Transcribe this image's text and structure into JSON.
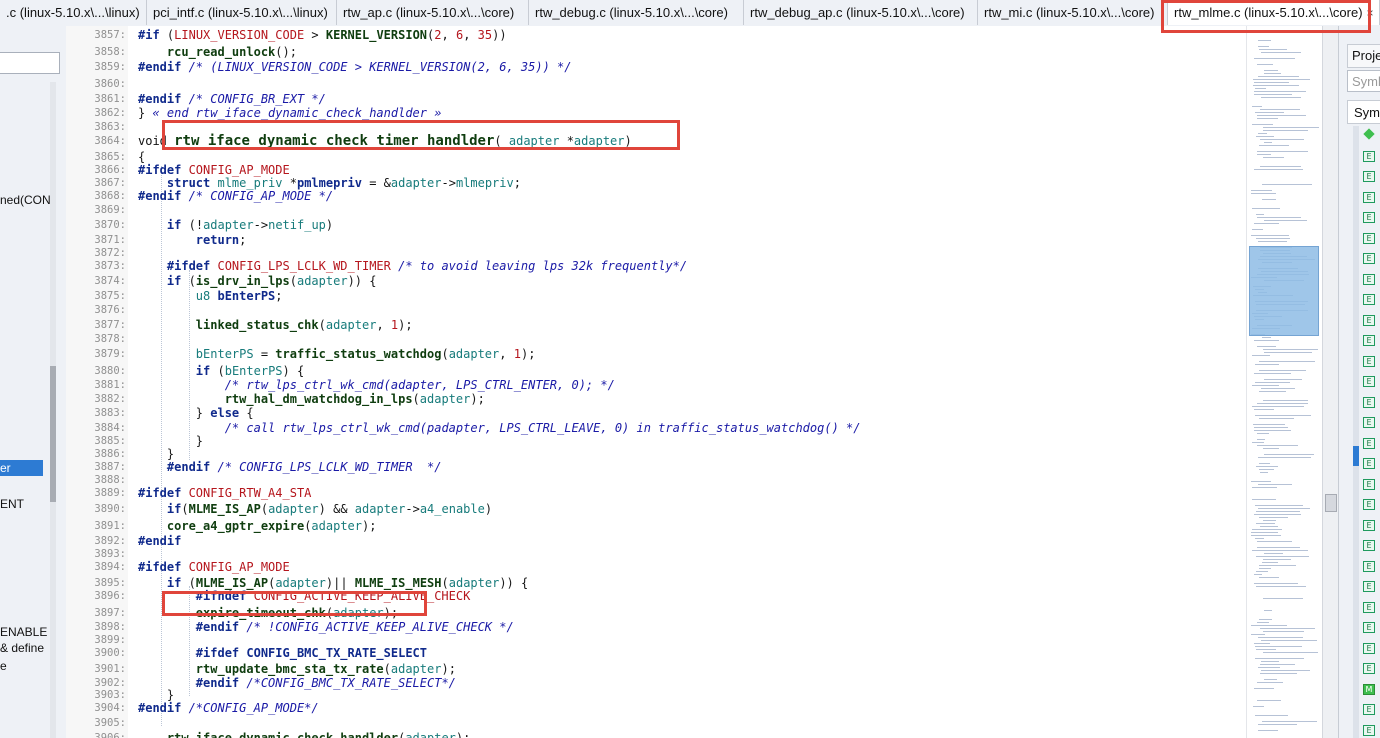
{
  "tabs": [
    {
      "label": ".c (linux-5.10.x\\...\\linux)",
      "active": false,
      "close": ""
    },
    {
      "label": "pci_intf.c (linux-5.10.x\\...\\linux)",
      "active": false,
      "close": ""
    },
    {
      "label": "rtw_ap.c (linux-5.10.x\\...\\core)",
      "active": false,
      "close": ""
    },
    {
      "label": "rtw_debug.c (linux-5.10.x\\...\\core)",
      "active": false,
      "close": ""
    },
    {
      "label": "rtw_debug_ap.c (linux-5.10.x\\...\\core)",
      "active": false,
      "close": ""
    },
    {
      "label": "rtw_mi.c (linux-5.10.x\\...\\core)",
      "active": false,
      "close": ""
    },
    {
      "label": "rtw_mlme.c (linux-5.10.x\\...\\core)",
      "active": true,
      "close": "×"
    }
  ],
  "left_panel": {
    "items": [
      {
        "label": "ned(CON",
        "selected": false
      },
      {
        "label": "er",
        "selected": true
      },
      {
        "label": "ENT",
        "selected": false
      },
      {
        "label": "ENABLE",
        "selected": false
      },
      {
        "label": "& define",
        "selected": false
      },
      {
        "label": "e",
        "selected": false
      }
    ]
  },
  "right_panel": {
    "tab_label": "Project",
    "search_placeholder": "Symbol",
    "header": "Symbol",
    "icons": [
      "diamond",
      "E",
      "E",
      "E",
      "E",
      "E",
      "E",
      "E",
      "E",
      "E",
      "E",
      "E",
      "E",
      "E",
      "E",
      "E",
      "E",
      "E",
      "E",
      "E",
      "E",
      "E",
      "E",
      "E",
      "E",
      "E",
      "E",
      "M",
      "E",
      "E"
    ]
  },
  "code": {
    "lines": [
      {
        "n": "3857:",
        "html_parts": [
          [
            "pp",
            "#if "
          ],
          [
            "par",
            "("
          ],
          [
            "mac",
            "LINUX_VERSION_CODE"
          ],
          [
            "plain",
            " > "
          ],
          [
            "fn",
            "KERNEL_VERSION"
          ],
          [
            "par",
            "("
          ],
          [
            "num",
            "2"
          ],
          [
            "plain",
            ", "
          ],
          [
            "num",
            "6"
          ],
          [
            "plain",
            ", "
          ],
          [
            "num",
            "35"
          ],
          [
            "par",
            "))"
          ]
        ]
      },
      {
        "n": "3858:",
        "html_parts": [
          [
            "plain",
            "    "
          ],
          [
            "fn",
            "rcu_read_unlock"
          ],
          [
            "par",
            "();"
          ]
        ]
      },
      {
        "n": "3859:",
        "html_parts": [
          [
            "pp",
            "#endif "
          ],
          [
            "cm",
            "/* (LINUX_VERSION_CODE > KERNEL_VERSION(2, 6, 35)) */"
          ]
        ]
      },
      {
        "n": "3860:",
        "html_parts": []
      },
      {
        "n": "3861:",
        "html_parts": [
          [
            "pp",
            "#endif "
          ],
          [
            "cm",
            "/* CONFIG_BR_EXT */"
          ]
        ]
      },
      {
        "n": "3862:",
        "html_parts": [
          [
            "par",
            "} "
          ],
          [
            "cm",
            "« end rtw_iface_dynamic_check_handlder »"
          ]
        ]
      },
      {
        "n": "3863:",
        "html_parts": []
      },
      {
        "n": "3864:",
        "html_parts": [
          [
            "plain",
            "void "
          ],
          [
            "fn big",
            "rtw_iface_dynamic_check_timer_handlder"
          ],
          [
            "par",
            "("
          ],
          [
            "var",
            "_adapter "
          ],
          [
            "plain",
            "*"
          ],
          [
            "var",
            "adapter"
          ],
          [
            "par",
            ")"
          ]
        ]
      },
      {
        "n": "3865:",
        "html_parts": [
          [
            "par",
            "{"
          ]
        ]
      },
      {
        "n": "3866:",
        "html_parts": [
          [
            "pp",
            "#ifdef "
          ],
          [
            "mac",
            "CONFIG_AP_MODE"
          ]
        ]
      },
      {
        "n": "3867:",
        "html_parts": [
          [
            "plain",
            "    "
          ],
          [
            "kw",
            "struct "
          ],
          [
            "var",
            "mlme_priv "
          ],
          [
            "plain",
            "*"
          ],
          [
            "kw",
            "pmlmepriv"
          ],
          [
            "plain",
            " = &"
          ],
          [
            "var",
            "adapter"
          ],
          [
            "plain",
            "->"
          ],
          [
            "var",
            "mlmepriv"
          ],
          [
            "plain",
            ";"
          ]
        ]
      },
      {
        "n": "3868:",
        "html_parts": [
          [
            "pp",
            "#endif "
          ],
          [
            "cm",
            "/* CONFIG_AP_MODE */"
          ]
        ]
      },
      {
        "n": "3869:",
        "html_parts": []
      },
      {
        "n": "3870:",
        "html_parts": [
          [
            "plain",
            "    "
          ],
          [
            "kw",
            "if "
          ],
          [
            "par",
            "("
          ],
          [
            "plain",
            "!"
          ],
          [
            "var",
            "adapter"
          ],
          [
            "plain",
            "->"
          ],
          [
            "var",
            "netif_up"
          ],
          [
            "par",
            ")"
          ]
        ]
      },
      {
        "n": "3871:",
        "html_parts": [
          [
            "plain",
            "        "
          ],
          [
            "kw",
            "return"
          ],
          [
            "plain",
            ";"
          ]
        ]
      },
      {
        "n": "3872:",
        "html_parts": []
      },
      {
        "n": "3873:",
        "html_parts": [
          [
            "plain",
            "    "
          ],
          [
            "pp",
            "#ifdef "
          ],
          [
            "mac",
            "CONFIG_LPS_LCLK_WD_TIMER "
          ],
          [
            "cm",
            "/* to avoid leaving lps 32k frequently*/"
          ]
        ]
      },
      {
        "n": "3874:",
        "html_parts": [
          [
            "plain",
            "    "
          ],
          [
            "kw",
            "if "
          ],
          [
            "par",
            "("
          ],
          [
            "fn",
            "is_drv_in_lps"
          ],
          [
            "par",
            "("
          ],
          [
            "var",
            "adapter"
          ],
          [
            "par",
            "))"
          ],
          [
            "plain",
            " {"
          ]
        ]
      },
      {
        "n": "3875:",
        "html_parts": [
          [
            "plain",
            "        "
          ],
          [
            "var",
            "u8 "
          ],
          [
            "kw",
            "bEnterPS"
          ],
          [
            "plain",
            ";"
          ]
        ]
      },
      {
        "n": "3876:",
        "html_parts": []
      },
      {
        "n": "3877:",
        "html_parts": [
          [
            "plain",
            "        "
          ],
          [
            "fn",
            "linked_status_chk"
          ],
          [
            "par",
            "("
          ],
          [
            "var",
            "adapter"
          ],
          [
            "plain",
            ", "
          ],
          [
            "num",
            "1"
          ],
          [
            "par",
            ")"
          ],
          [
            "plain",
            ";"
          ]
        ]
      },
      {
        "n": "3878:",
        "html_parts": []
      },
      {
        "n": "3879:",
        "html_parts": [
          [
            "plain",
            "        "
          ],
          [
            "var",
            "bEnterPS"
          ],
          [
            "plain",
            " = "
          ],
          [
            "fn",
            "traffic_status_watchdog"
          ],
          [
            "par",
            "("
          ],
          [
            "var",
            "adapter"
          ],
          [
            "plain",
            ", "
          ],
          [
            "num",
            "1"
          ],
          [
            "par",
            ")"
          ],
          [
            "plain",
            ";"
          ]
        ]
      },
      {
        "n": "3880:",
        "html_parts": [
          [
            "plain",
            "        "
          ],
          [
            "kw",
            "if "
          ],
          [
            "par",
            "("
          ],
          [
            "var",
            "bEnterPS"
          ],
          [
            "par",
            ")"
          ],
          [
            "plain",
            " {"
          ]
        ]
      },
      {
        "n": "3881:",
        "html_parts": [
          [
            "plain",
            "            "
          ],
          [
            "cm",
            "/* rtw_lps_ctrl_wk_cmd(adapter, LPS_CTRL_ENTER, 0); */"
          ]
        ]
      },
      {
        "n": "3882:",
        "html_parts": [
          [
            "plain",
            "            "
          ],
          [
            "fn",
            "rtw_hal_dm_watchdog_in_lps"
          ],
          [
            "par",
            "("
          ],
          [
            "var",
            "adapter"
          ],
          [
            "par",
            ")"
          ],
          [
            "plain",
            ";"
          ]
        ]
      },
      {
        "n": "3883:",
        "html_parts": [
          [
            "plain",
            "        "
          ],
          [
            "par",
            "} "
          ],
          [
            "kw",
            "else "
          ],
          [
            "par",
            "{"
          ]
        ]
      },
      {
        "n": "3884:",
        "html_parts": [
          [
            "plain",
            "            "
          ],
          [
            "cm",
            "/* call rtw_lps_ctrl_wk_cmd(padapter, LPS_CTRL_LEAVE, 0) in traffic_status_watchdog() */"
          ]
        ]
      },
      {
        "n": "3885:",
        "html_parts": [
          [
            "plain",
            "        "
          ],
          [
            "par",
            "}"
          ]
        ]
      },
      {
        "n": "3886:",
        "html_parts": [
          [
            "plain",
            "    "
          ],
          [
            "par",
            "}"
          ]
        ]
      },
      {
        "n": "3887:",
        "html_parts": [
          [
            "plain",
            "    "
          ],
          [
            "pp",
            "#endif "
          ],
          [
            "cm",
            "/* CONFIG_LPS_LCLK_WD_TIMER  */"
          ]
        ]
      },
      {
        "n": "3888:",
        "html_parts": []
      },
      {
        "n": "3889:",
        "html_parts": [
          [
            "pp",
            "#ifdef "
          ],
          [
            "mac",
            "CONFIG_RTW_A4_STA"
          ]
        ]
      },
      {
        "n": "3890:",
        "html_parts": [
          [
            "plain",
            "    "
          ],
          [
            "kw",
            "if"
          ],
          [
            "par",
            "("
          ],
          [
            "fn",
            "MLME_IS_AP"
          ],
          [
            "par",
            "("
          ],
          [
            "var",
            "adapter"
          ],
          [
            "par",
            ")"
          ],
          [
            "plain",
            " && "
          ],
          [
            "var",
            "adapter"
          ],
          [
            "plain",
            "->"
          ],
          [
            "var",
            "a4_enable"
          ],
          [
            "par",
            ")"
          ]
        ]
      },
      {
        "n": "3891:",
        "html_parts": [
          [
            "plain",
            "    "
          ],
          [
            "fn",
            "core_a4_gptr_expire"
          ],
          [
            "par",
            "("
          ],
          [
            "var",
            "adapter"
          ],
          [
            "par",
            ")"
          ],
          [
            "plain",
            ";"
          ]
        ]
      },
      {
        "n": "3892:",
        "html_parts": [
          [
            "pp",
            "#endif"
          ]
        ]
      },
      {
        "n": "3893:",
        "html_parts": []
      },
      {
        "n": "3894:",
        "html_parts": [
          [
            "pp",
            "#ifdef "
          ],
          [
            "mac",
            "CONFIG_AP_MODE"
          ]
        ]
      },
      {
        "n": "3895:",
        "html_parts": [
          [
            "plain",
            "    "
          ],
          [
            "kw",
            "if "
          ],
          [
            "par",
            "("
          ],
          [
            "fn",
            "MLME_IS_AP"
          ],
          [
            "par",
            "("
          ],
          [
            "var",
            "adapter"
          ],
          [
            "par",
            ")"
          ],
          [
            "plain",
            "|| "
          ],
          [
            "fn",
            "MLME_IS_MESH"
          ],
          [
            "par",
            "("
          ],
          [
            "var",
            "adapter"
          ],
          [
            "par",
            "))"
          ],
          [
            "plain",
            " {"
          ]
        ]
      },
      {
        "n": "3896:",
        "html_parts": [
          [
            "plain",
            "        "
          ],
          [
            "pp",
            "#ifndef "
          ],
          [
            "mac",
            "CONFIG_ACTIVE_KEEP_ALIVE_CHECK"
          ]
        ]
      },
      {
        "n": "3897:",
        "html_parts": [
          [
            "plain",
            "        "
          ],
          [
            "fn",
            "expire_timeout_chk"
          ],
          [
            "par",
            "("
          ],
          [
            "var",
            "adapter"
          ],
          [
            "par",
            ")"
          ],
          [
            "plain",
            ";"
          ]
        ]
      },
      {
        "n": "3898:",
        "html_parts": [
          [
            "plain",
            "        "
          ],
          [
            "pp",
            "#endif "
          ],
          [
            "cm",
            "/* !CONFIG_ACTIVE_KEEP_ALIVE_CHECK */"
          ]
        ]
      },
      {
        "n": "3899:",
        "html_parts": []
      },
      {
        "n": "3900:",
        "html_parts": [
          [
            "plain",
            "        "
          ],
          [
            "pp",
            "#ifdef "
          ],
          [
            "kw",
            "CONFIG_BMC_TX_RATE_SELECT"
          ]
        ]
      },
      {
        "n": "3901:",
        "html_parts": [
          [
            "plain",
            "        "
          ],
          [
            "fn",
            "rtw_update_bmc_sta_tx_rate"
          ],
          [
            "par",
            "("
          ],
          [
            "var",
            "adapter"
          ],
          [
            "par",
            ")"
          ],
          [
            "plain",
            ";"
          ]
        ]
      },
      {
        "n": "3902:",
        "html_parts": [
          [
            "plain",
            "        "
          ],
          [
            "pp",
            "#endif "
          ],
          [
            "cm",
            "/*CONFIG_BMC_TX_RATE_SELECT*/"
          ]
        ]
      },
      {
        "n": "3903:",
        "html_parts": [
          [
            "plain",
            "    "
          ],
          [
            "par",
            "}"
          ]
        ]
      },
      {
        "n": "3904:",
        "html_parts": [
          [
            "pp",
            "#endif "
          ],
          [
            "cm",
            "/*CONFIG_AP_MODE*/"
          ]
        ]
      },
      {
        "n": "3905:",
        "html_parts": []
      },
      {
        "n": "3906:",
        "html_parts": [
          [
            "plain",
            "    "
          ],
          [
            "fn",
            "rtw_iface_dynamic_check_handlder"
          ],
          [
            "par",
            "("
          ],
          [
            "var",
            "adapter"
          ],
          [
            "par",
            ")"
          ],
          [
            "plain",
            ";"
          ]
        ]
      }
    ]
  }
}
